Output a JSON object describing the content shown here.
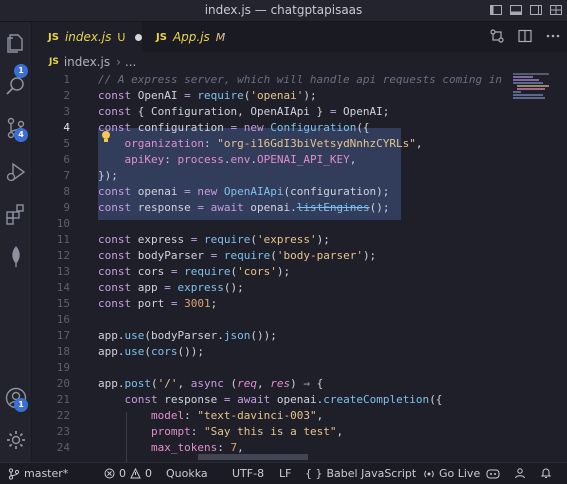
{
  "window": {
    "title": "index.js — chatgptapisaas"
  },
  "tabs": [
    {
      "badge": "JS",
      "name": "index.js",
      "status": "U",
      "dirty": true
    },
    {
      "badge": "JS",
      "name": "App.js",
      "status": "M"
    }
  ],
  "breadcrumb": {
    "badge": "JS",
    "file": "index.js",
    "sep": "›",
    "rest": "..."
  },
  "activity_bar": {
    "explorer_badge": "1",
    "source_control_badge": "4",
    "accounts_badge": "1"
  },
  "editor": {
    "current_line": 4,
    "lines": [
      {
        "n": "1",
        "tokens": [
          [
            "cm",
            "// A express server, which will handle api requests coming in"
          ]
        ]
      },
      {
        "n": "2",
        "tokens": [
          [
            "kw",
            "const"
          ],
          [
            "va",
            " OpenAI "
          ],
          [
            "kw",
            "="
          ],
          [
            "va",
            " "
          ],
          [
            "fn",
            "require"
          ],
          [
            "va",
            "("
          ],
          [
            "st",
            "'openai'"
          ],
          [
            "va",
            ");"
          ]
        ]
      },
      {
        "n": "3",
        "tokens": [
          [
            "kw",
            "const"
          ],
          [
            "va",
            " { Configuration, OpenAIApi } "
          ],
          [
            "kw",
            "="
          ],
          [
            "va",
            " OpenAI;"
          ]
        ]
      },
      {
        "n": "4",
        "tokens": [
          [
            "kw",
            "const"
          ],
          [
            "va",
            " configuration "
          ],
          [
            "kw",
            "="
          ],
          [
            "va",
            " "
          ],
          [
            "kw",
            "new"
          ],
          [
            "va",
            " "
          ],
          [
            "fn",
            "Configuration"
          ],
          [
            "va",
            "({"
          ]
        ]
      },
      {
        "n": "5",
        "tokens": [
          [
            "va",
            "    "
          ],
          [
            "pr",
            "organization"
          ],
          [
            "va",
            ": "
          ],
          [
            "st",
            "\"org-i16GdI3biVetsydNnhzCYRLs\""
          ],
          [
            "va",
            ","
          ]
        ]
      },
      {
        "n": "6",
        "tokens": [
          [
            "va",
            "    "
          ],
          [
            "pr",
            "apiKey"
          ],
          [
            "va",
            ": "
          ],
          [
            "pr",
            "process"
          ],
          [
            "va",
            "."
          ],
          [
            "pr",
            "env"
          ],
          [
            "va",
            "."
          ],
          [
            "pr",
            "OPENAI_API_KEY"
          ],
          [
            "va",
            ","
          ]
        ]
      },
      {
        "n": "7",
        "tokens": [
          [
            "va",
            "});"
          ]
        ]
      },
      {
        "n": "8",
        "tokens": [
          [
            "kw",
            "const"
          ],
          [
            "va",
            " openai "
          ],
          [
            "kw",
            "="
          ],
          [
            "va",
            " "
          ],
          [
            "kw",
            "new"
          ],
          [
            "va",
            " "
          ],
          [
            "fn",
            "OpenAIApi"
          ],
          [
            "va",
            "(configuration);"
          ]
        ]
      },
      {
        "n": "9",
        "tokens": [
          [
            "kw",
            "const"
          ],
          [
            "va",
            " response "
          ],
          [
            "kw",
            "="
          ],
          [
            "va",
            " "
          ],
          [
            "kw",
            "await"
          ],
          [
            "va",
            " openai."
          ],
          [
            "fn strike",
            "listEngines"
          ],
          [
            "va",
            "();"
          ]
        ]
      },
      {
        "n": "10",
        "tokens": []
      },
      {
        "n": "11",
        "tokens": [
          [
            "kw",
            "const"
          ],
          [
            "va",
            " express "
          ],
          [
            "kw",
            "="
          ],
          [
            "va",
            " "
          ],
          [
            "fn",
            "require"
          ],
          [
            "va",
            "("
          ],
          [
            "st",
            "'express'"
          ],
          [
            "va",
            ");"
          ]
        ]
      },
      {
        "n": "12",
        "tokens": [
          [
            "kw",
            "const"
          ],
          [
            "va",
            " bodyParser "
          ],
          [
            "kw",
            "="
          ],
          [
            "va",
            " "
          ],
          [
            "fn",
            "require"
          ],
          [
            "va",
            "("
          ],
          [
            "st",
            "'body-parser'"
          ],
          [
            "va",
            ");"
          ]
        ]
      },
      {
        "n": "13",
        "tokens": [
          [
            "kw",
            "const"
          ],
          [
            "va",
            " cors "
          ],
          [
            "kw",
            "="
          ],
          [
            "va",
            " "
          ],
          [
            "fn",
            "require"
          ],
          [
            "va",
            "("
          ],
          [
            "st",
            "'cors'"
          ],
          [
            "va",
            ");"
          ]
        ]
      },
      {
        "n": "14",
        "tokens": [
          [
            "kw",
            "const"
          ],
          [
            "va",
            " app "
          ],
          [
            "kw",
            "="
          ],
          [
            "va",
            " "
          ],
          [
            "fn",
            "express"
          ],
          [
            "va",
            "();"
          ]
        ]
      },
      {
        "n": "15",
        "tokens": [
          [
            "kw",
            "const"
          ],
          [
            "va",
            " port "
          ],
          [
            "kw",
            "="
          ],
          [
            "va",
            " "
          ],
          [
            "nm",
            "3001"
          ],
          [
            "va",
            ";"
          ]
        ]
      },
      {
        "n": "16",
        "tokens": []
      },
      {
        "n": "17",
        "tokens": [
          [
            "va",
            "app."
          ],
          [
            "fn",
            "use"
          ],
          [
            "va",
            "(bodyParser."
          ],
          [
            "fn",
            "json"
          ],
          [
            "va",
            "());"
          ]
        ]
      },
      {
        "n": "18",
        "tokens": [
          [
            "va",
            "app."
          ],
          [
            "fn",
            "use"
          ],
          [
            "va",
            "("
          ],
          [
            "fn",
            "cors"
          ],
          [
            "va",
            "());"
          ]
        ]
      },
      {
        "n": "19",
        "tokens": []
      },
      {
        "n": "20",
        "tokens": [
          [
            "va",
            "app."
          ],
          [
            "fn",
            "post"
          ],
          [
            "va",
            "("
          ],
          [
            "st",
            "'/'"
          ],
          [
            "va",
            ", "
          ],
          [
            "kw",
            "async"
          ],
          [
            "va",
            " ("
          ],
          [
            "pm",
            "req"
          ],
          [
            "va",
            ", "
          ],
          [
            "pm",
            "res"
          ],
          [
            "va",
            ") "
          ],
          [
            "kw",
            "⇒"
          ],
          [
            "va",
            " {"
          ]
        ]
      },
      {
        "n": "21",
        "tokens": [
          [
            "va",
            "    "
          ],
          [
            "kw",
            "const"
          ],
          [
            "va",
            " response "
          ],
          [
            "kw",
            "="
          ],
          [
            "va",
            " "
          ],
          [
            "kw",
            "await"
          ],
          [
            "va",
            " openai."
          ],
          [
            "fn",
            "createCompletion"
          ],
          [
            "va",
            "({"
          ]
        ]
      },
      {
        "n": "22",
        "tokens": [
          [
            "va",
            "        "
          ],
          [
            "pr",
            "model"
          ],
          [
            "va",
            ": "
          ],
          [
            "st",
            "\"text-davinci-003\""
          ],
          [
            "va",
            ","
          ]
        ]
      },
      {
        "n": "23",
        "tokens": [
          [
            "va",
            "        "
          ],
          [
            "pr",
            "prompt"
          ],
          [
            "va",
            ": "
          ],
          [
            "st",
            "\"Say this is a test\""
          ],
          [
            "va",
            ","
          ]
        ]
      },
      {
        "n": "24",
        "tokens": [
          [
            "va",
            "        "
          ],
          [
            "pr",
            "max_tokens"
          ],
          [
            "va",
            ": "
          ],
          [
            "nm",
            "7"
          ],
          [
            "va",
            ","
          ]
        ]
      }
    ]
  },
  "statusbar": {
    "branch": "master*",
    "errors": "0",
    "warnings": "0",
    "quokka": "Quokka",
    "encoding": "UTF-8",
    "eol": "LF",
    "language": "Babel JavaScript",
    "golive": "Go Live"
  },
  "colors": {
    "accent_badge": "#3b6fd6",
    "js_yellow": "#e8d44d",
    "keyword": "#c59de2",
    "function": "#7dc1ec",
    "string": "#e8c489"
  }
}
